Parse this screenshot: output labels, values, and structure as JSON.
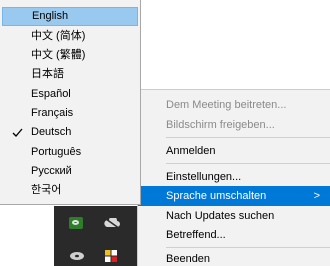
{
  "language_menu": {
    "items": [
      {
        "label": "English",
        "highlighted": true,
        "checked": false
      },
      {
        "label": "中文 (简体)",
        "highlighted": false,
        "checked": false
      },
      {
        "label": "中文 (繁體)",
        "highlighted": false,
        "checked": false
      },
      {
        "label": "日本語",
        "highlighted": false,
        "checked": false
      },
      {
        "label": "Español",
        "highlighted": false,
        "checked": false
      },
      {
        "label": "Français",
        "highlighted": false,
        "checked": false
      },
      {
        "label": "Deutsch",
        "highlighted": false,
        "checked": true
      },
      {
        "label": "Português",
        "highlighted": false,
        "checked": false
      },
      {
        "label": "Русский",
        "highlighted": false,
        "checked": false
      },
      {
        "label": "한국어",
        "highlighted": false,
        "checked": false
      }
    ],
    "check_icon": "checkmark-icon"
  },
  "context_menu": {
    "join_meeting": "Dem Meeting beitreten...",
    "share_screen": "Bildschirm freigeben...",
    "sign_in": "Anmelden",
    "settings": "Einstellungen...",
    "switch_language": "Sprache umschalten",
    "submenu_arrow": ">",
    "check_updates": "Nach Updates suchen",
    "about": "Betreffend...",
    "quit": "Beenden"
  },
  "tray": {
    "icons": [
      "nvidia-icon",
      "cloud-sync-icon",
      "disc-icon",
      "security-shield-icon"
    ]
  },
  "colors": {
    "menu_bg": "#f2f2f2",
    "highlight_blue": "#0078d7",
    "language_highlight": "#99c9ef",
    "disabled_text": "#8a8a8a",
    "taskbar": "#2a2a2a"
  }
}
